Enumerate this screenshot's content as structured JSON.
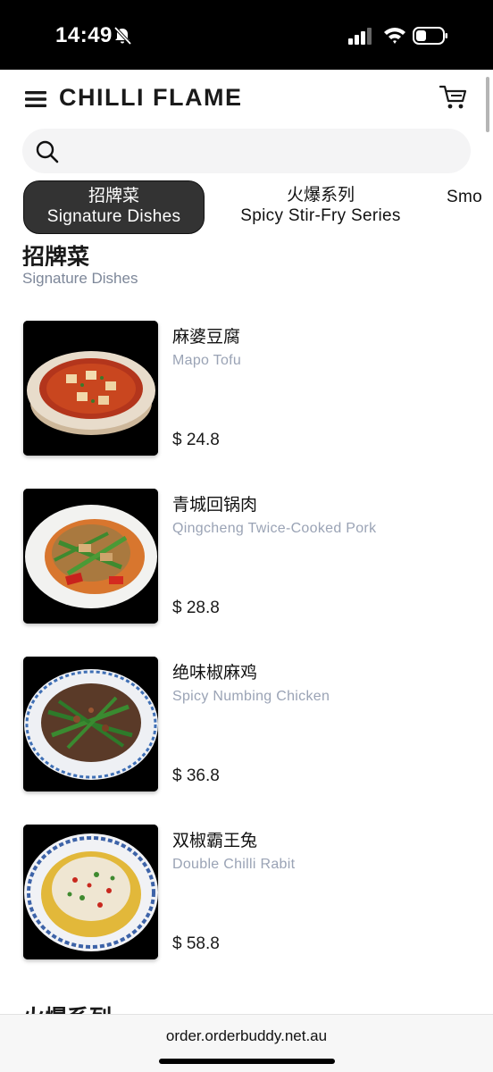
{
  "status_bar": {
    "time": "14:49",
    "icons": [
      "bell-slash-icon",
      "signal-icon",
      "wifi-icon",
      "battery-icon"
    ]
  },
  "header": {
    "brand": "CHILLI FLAME",
    "icons": [
      "menu-icon",
      "cart-icon"
    ]
  },
  "search": {
    "placeholder": "",
    "value": ""
  },
  "tabs": [
    {
      "zh": "招牌菜",
      "en": "Signature Dishes",
      "active": true
    },
    {
      "zh": "火爆系列",
      "en": "Spicy Stir-Fry Series",
      "active": false
    },
    {
      "zh": "",
      "en": "Smo",
      "active": false
    }
  ],
  "section": {
    "title_zh": "招牌菜",
    "title_en": "Signature Dishes"
  },
  "dishes": [
    {
      "name_zh": "麻婆豆腐",
      "name_en": "Mapo Tofu",
      "price": "$ 24.8"
    },
    {
      "name_zh": "青城回锅肉",
      "name_en": "Qingcheng Twice-Cooked Pork",
      "price": "$ 28.8"
    },
    {
      "name_zh": "绝味椒麻鸡",
      "name_en": "Spicy Numbing Chicken",
      "price": "$ 36.8"
    },
    {
      "name_zh": "双椒霸王兔",
      "name_en": "Double Chilli Rabit",
      "price": "$ 58.8"
    }
  ],
  "next_section": {
    "title_zh": "火爆系列"
  },
  "browser": {
    "url": "order.orderbuddy.net.au"
  },
  "colors": {
    "active_tab_bg": "#333333",
    "subtitle_grey": "#9aa3b5",
    "status_bar_bg": "#000000"
  }
}
